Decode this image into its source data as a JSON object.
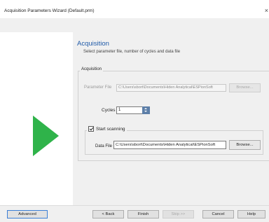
{
  "window": {
    "title": "Acquisition Parameters Wizard (Default.prm)",
    "close_glyph": "×"
  },
  "page": {
    "heading": "Acquisition",
    "subheading": "Select parameter file, number of cycles and data file"
  },
  "acquisition_group": {
    "legend": "Acquisition",
    "parameter_file_label": "Parameter File",
    "parameter_file_value": "C:\\Users\\sbort\\Documents\\Hiden Analytical\\ESPionSoft",
    "browse_label": "Browse...",
    "cycles_label": "Cycles",
    "cycles_value": "1"
  },
  "scanning_group": {
    "legend": "Start scanning",
    "checked": true,
    "data_file_label": "Data File",
    "data_file_value": "C:\\Users\\sbort\\Documents\\Hiden Analytical\\ESPionSoft",
    "browse_label": "Browse..."
  },
  "footer": {
    "advanced": "Advanced",
    "back": "< Back",
    "finish": "Finish",
    "skip": "Skip >>",
    "cancel": "Cancel",
    "help": "Help"
  },
  "colors": {
    "accent": "#1f5aa8",
    "play_icon": "#2fb34a",
    "panel": "#f0f0f0"
  },
  "icons": [
    "close-icon",
    "play-icon",
    "spin-up-icon",
    "spin-down-icon",
    "checkbox-icon"
  ]
}
